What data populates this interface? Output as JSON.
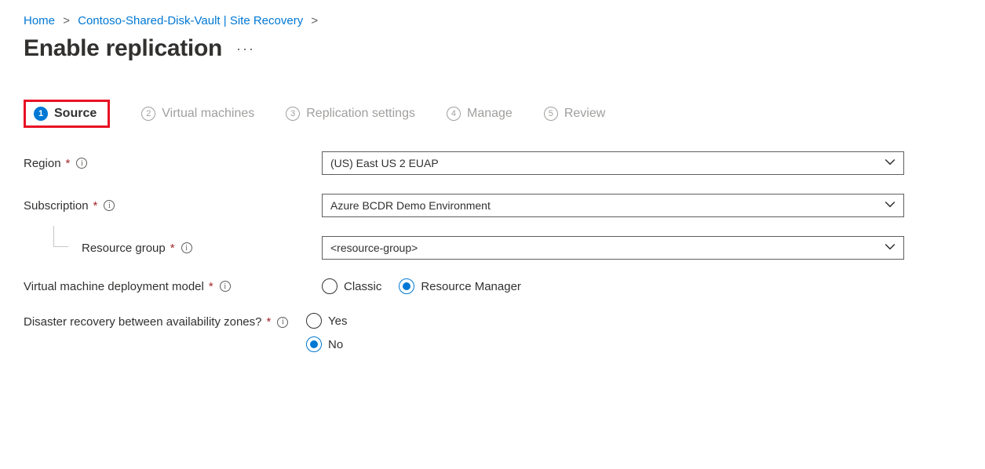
{
  "breadcrumb": {
    "home": "Home",
    "vault": "Contoso-Shared-Disk-Vault | Site Recovery"
  },
  "title": "Enable replication",
  "steps": [
    {
      "num": "1",
      "label": "Source"
    },
    {
      "num": "2",
      "label": "Virtual machines"
    },
    {
      "num": "3",
      "label": "Replication settings"
    },
    {
      "num": "4",
      "label": "Manage"
    },
    {
      "num": "5",
      "label": "Review"
    }
  ],
  "form": {
    "region": {
      "label": "Region",
      "value": "(US) East US 2 EUAP"
    },
    "subscription": {
      "label": "Subscription",
      "value": "Azure BCDR Demo Environment"
    },
    "resource_group": {
      "label": "Resource group",
      "value": "<resource-group>"
    },
    "deploy_model": {
      "label": "Virtual machine deployment model",
      "opt_classic": "Classic",
      "opt_rm": "Resource Manager"
    },
    "dr_zones": {
      "label": "Disaster recovery between availability zones?",
      "opt_yes": "Yes",
      "opt_no": "No"
    }
  }
}
